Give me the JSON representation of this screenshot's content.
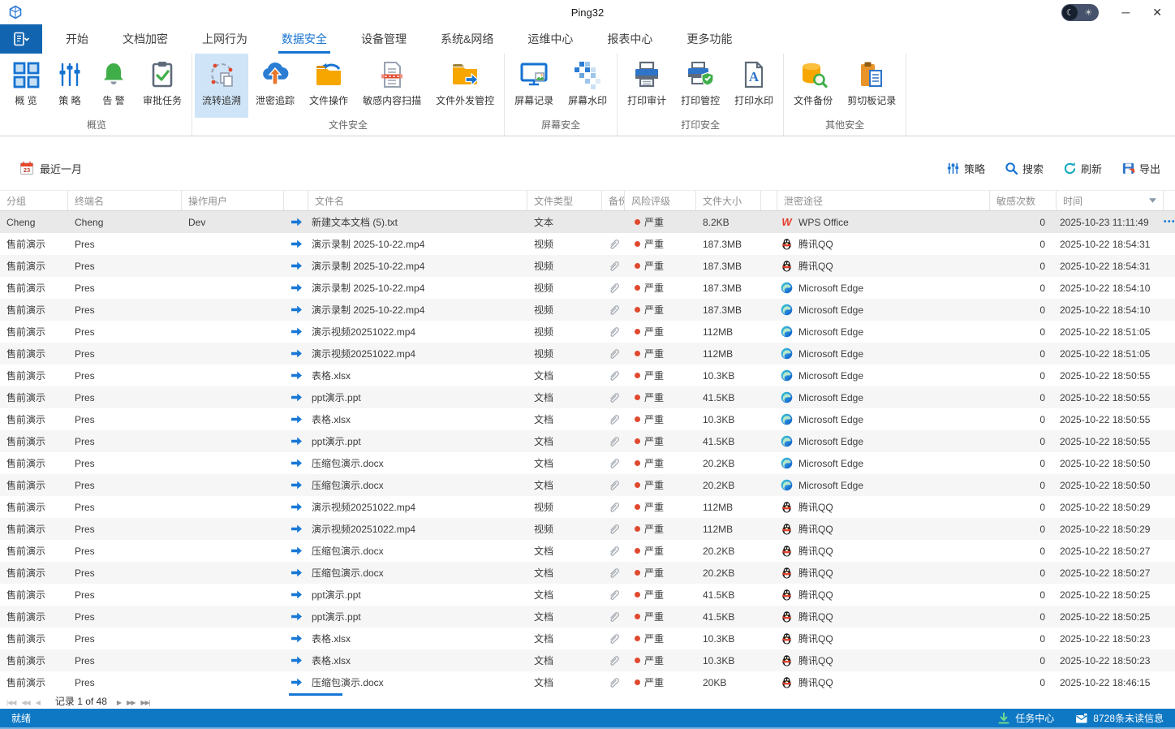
{
  "window": {
    "title": "Ping32",
    "controls": {
      "minimize": "─",
      "close": "✕"
    },
    "theme_toggle": {
      "moon": "☾",
      "sun": "☀"
    }
  },
  "tabs": {
    "active_index": 3,
    "items": [
      "开始",
      "文档加密",
      "上网行为",
      "数据安全",
      "设备管理",
      "系统&网络",
      "运维中心",
      "报表中心",
      "更多功能"
    ]
  },
  "ribbon": {
    "groups": [
      {
        "label": "概览",
        "buttons": [
          {
            "key": "overview",
            "label": "概 览",
            "icon": "overview-grid-icon",
            "active": false
          },
          {
            "key": "policy",
            "label": "策 略",
            "icon": "policy-sliders-icon",
            "active": false
          },
          {
            "key": "alert",
            "label": "告 警",
            "icon": "alert-bell-icon",
            "active": false
          },
          {
            "key": "approval-tasks",
            "label": "审批任务",
            "icon": "approval-clipboard-icon",
            "active": false
          }
        ]
      },
      {
        "label": "文件安全",
        "buttons": [
          {
            "key": "flow-trace",
            "label": "流转追溯",
            "icon": "flow-trace-icon",
            "active": true
          },
          {
            "key": "leak-track",
            "label": "泄密追踪",
            "icon": "leak-track-cloud-icon",
            "active": false
          },
          {
            "key": "file-ops",
            "label": "文件操作",
            "icon": "file-ops-folder-icon",
            "active": false
          },
          {
            "key": "content-scan",
            "label": "敏感内容扫描",
            "icon": "content-scan-icon",
            "active": false
          },
          {
            "key": "file-outgoing",
            "label": "文件外发管控",
            "icon": "file-outgoing-folder-icon",
            "active": false
          }
        ]
      },
      {
        "label": "屏幕安全",
        "buttons": [
          {
            "key": "screen-record",
            "label": "屏幕记录",
            "icon": "screen-record-icon",
            "active": false
          },
          {
            "key": "screen-watermark",
            "label": "屏幕水印",
            "icon": "screen-watermark-icon",
            "active": false
          }
        ]
      },
      {
        "label": "打印安全",
        "buttons": [
          {
            "key": "print-audit",
            "label": "打印审计",
            "icon": "print-audit-icon",
            "active": false
          },
          {
            "key": "print-control",
            "label": "打印管控",
            "icon": "print-control-icon",
            "active": false
          },
          {
            "key": "print-watermark",
            "label": "打印水印",
            "icon": "print-watermark-icon",
            "active": false
          }
        ]
      },
      {
        "label": "其他安全",
        "buttons": [
          {
            "key": "file-backup",
            "label": "文件备份",
            "icon": "file-backup-icon",
            "active": false
          },
          {
            "key": "clipboard-record",
            "label": "剪切板记录",
            "icon": "clipboard-record-icon",
            "active": false
          }
        ]
      }
    ]
  },
  "filterbar": {
    "date_range": "最近一月",
    "calendar_day": "23",
    "actions": [
      {
        "key": "policy",
        "label": "策略",
        "icon": "policy-filter-icon"
      },
      {
        "key": "search",
        "label": "搜索",
        "icon": "search-icon"
      },
      {
        "key": "refresh",
        "label": "刷新",
        "icon": "refresh-icon"
      },
      {
        "key": "export",
        "label": "导出",
        "icon": "export-icon"
      }
    ]
  },
  "table": {
    "risk_color": "#e0492e",
    "accent_color": "#1778d6",
    "columns": [
      {
        "label": "分组"
      },
      {
        "label": "终端名"
      },
      {
        "label": "操作用户"
      },
      {
        "label": ""
      },
      {
        "label": "文件名"
      },
      {
        "label": "文件类型"
      },
      {
        "label": "备份"
      },
      {
        "label": "风险评级"
      },
      {
        "label": "文件大小"
      },
      {
        "label": ""
      },
      {
        "label": "泄密途径"
      },
      {
        "label": "敏感次数"
      },
      {
        "label": "时间",
        "filter_arrow": true
      },
      {
        "label": ""
      }
    ],
    "rows": [
      {
        "group": "Cheng",
        "terminal": "Cheng",
        "user": "Dev",
        "file": "新建文本文档 (5).txt",
        "type": "文本",
        "backup": false,
        "risk": "严重",
        "size": "8.2KB",
        "channel": "wps",
        "channel_label": "WPS Office",
        "count": "0",
        "time": "2025-10-23 11:11:49",
        "selected": true,
        "actions": "•••"
      },
      {
        "group": "售前演示",
        "terminal": "Pres",
        "user": "",
        "file": "演示录制 2025-10-22.mp4",
        "type": "视频",
        "backup": true,
        "risk": "严重",
        "size": "187.3MB",
        "channel": "qq",
        "channel_label": "腾讯QQ",
        "count": "0",
        "time": "2025-10-22 18:54:31"
      },
      {
        "group": "售前演示",
        "terminal": "Pres",
        "user": "",
        "file": "演示录制 2025-10-22.mp4",
        "type": "视频",
        "backup": true,
        "risk": "严重",
        "size": "187.3MB",
        "channel": "qq",
        "channel_label": "腾讯QQ",
        "count": "0",
        "time": "2025-10-22 18:54:31"
      },
      {
        "group": "售前演示",
        "terminal": "Pres",
        "user": "",
        "file": "演示录制 2025-10-22.mp4",
        "type": "视频",
        "backup": true,
        "risk": "严重",
        "size": "187.3MB",
        "channel": "edge",
        "channel_label": "Microsoft Edge",
        "count": "0",
        "time": "2025-10-22 18:54:10"
      },
      {
        "group": "售前演示",
        "terminal": "Pres",
        "user": "",
        "file": "演示录制 2025-10-22.mp4",
        "type": "视频",
        "backup": true,
        "risk": "严重",
        "size": "187.3MB",
        "channel": "edge",
        "channel_label": "Microsoft Edge",
        "count": "0",
        "time": "2025-10-22 18:54:10"
      },
      {
        "group": "售前演示",
        "terminal": "Pres",
        "user": "",
        "file": "演示视频20251022.mp4",
        "type": "视频",
        "backup": true,
        "risk": "严重",
        "size": "112MB",
        "channel": "edge",
        "channel_label": "Microsoft Edge",
        "count": "0",
        "time": "2025-10-22 18:51:05"
      },
      {
        "group": "售前演示",
        "terminal": "Pres",
        "user": "",
        "file": "演示视频20251022.mp4",
        "type": "视频",
        "backup": true,
        "risk": "严重",
        "size": "112MB",
        "channel": "edge",
        "channel_label": "Microsoft Edge",
        "count": "0",
        "time": "2025-10-22 18:51:05"
      },
      {
        "group": "售前演示",
        "terminal": "Pres",
        "user": "",
        "file": "表格.xlsx",
        "type": "文档",
        "backup": true,
        "risk": "严重",
        "size": "10.3KB",
        "channel": "edge",
        "channel_label": "Microsoft Edge",
        "count": "0",
        "time": "2025-10-22 18:50:55"
      },
      {
        "group": "售前演示",
        "terminal": "Pres",
        "user": "",
        "file": "ppt演示.ppt",
        "type": "文档",
        "backup": true,
        "risk": "严重",
        "size": "41.5KB",
        "channel": "edge",
        "channel_label": "Microsoft Edge",
        "count": "0",
        "time": "2025-10-22 18:50:55"
      },
      {
        "group": "售前演示",
        "terminal": "Pres",
        "user": "",
        "file": "表格.xlsx",
        "type": "文档",
        "backup": true,
        "risk": "严重",
        "size": "10.3KB",
        "channel": "edge",
        "channel_label": "Microsoft Edge",
        "count": "0",
        "time": "2025-10-22 18:50:55"
      },
      {
        "group": "售前演示",
        "terminal": "Pres",
        "user": "",
        "file": "ppt演示.ppt",
        "type": "文档",
        "backup": true,
        "risk": "严重",
        "size": "41.5KB",
        "channel": "edge",
        "channel_label": "Microsoft Edge",
        "count": "0",
        "time": "2025-10-22 18:50:55"
      },
      {
        "group": "售前演示",
        "terminal": "Pres",
        "user": "",
        "file": "压缩包演示.docx",
        "type": "文档",
        "backup": true,
        "risk": "严重",
        "size": "20.2KB",
        "channel": "edge",
        "channel_label": "Microsoft Edge",
        "count": "0",
        "time": "2025-10-22 18:50:50"
      },
      {
        "group": "售前演示",
        "terminal": "Pres",
        "user": "",
        "file": "压缩包演示.docx",
        "type": "文档",
        "backup": true,
        "risk": "严重",
        "size": "20.2KB",
        "channel": "edge",
        "channel_label": "Microsoft Edge",
        "count": "0",
        "time": "2025-10-22 18:50:50"
      },
      {
        "group": "售前演示",
        "terminal": "Pres",
        "user": "",
        "file": "演示视频20251022.mp4",
        "type": "视频",
        "backup": true,
        "risk": "严重",
        "size": "112MB",
        "channel": "qq",
        "channel_label": "腾讯QQ",
        "count": "0",
        "time": "2025-10-22 18:50:29"
      },
      {
        "group": "售前演示",
        "terminal": "Pres",
        "user": "",
        "file": "演示视频20251022.mp4",
        "type": "视频",
        "backup": true,
        "risk": "严重",
        "size": "112MB",
        "channel": "qq",
        "channel_label": "腾讯QQ",
        "count": "0",
        "time": "2025-10-22 18:50:29"
      },
      {
        "group": "售前演示",
        "terminal": "Pres",
        "user": "",
        "file": "压缩包演示.docx",
        "type": "文档",
        "backup": true,
        "risk": "严重",
        "size": "20.2KB",
        "channel": "qq",
        "channel_label": "腾讯QQ",
        "count": "0",
        "time": "2025-10-22 18:50:27"
      },
      {
        "group": "售前演示",
        "terminal": "Pres",
        "user": "",
        "file": "压缩包演示.docx",
        "type": "文档",
        "backup": true,
        "risk": "严重",
        "size": "20.2KB",
        "channel": "qq",
        "channel_label": "腾讯QQ",
        "count": "0",
        "time": "2025-10-22 18:50:27"
      },
      {
        "group": "售前演示",
        "terminal": "Pres",
        "user": "",
        "file": "ppt演示.ppt",
        "type": "文档",
        "backup": true,
        "risk": "严重",
        "size": "41.5KB",
        "channel": "qq",
        "channel_label": "腾讯QQ",
        "count": "0",
        "time": "2025-10-22 18:50:25"
      },
      {
        "group": "售前演示",
        "terminal": "Pres",
        "user": "",
        "file": "ppt演示.ppt",
        "type": "文档",
        "backup": true,
        "risk": "严重",
        "size": "41.5KB",
        "channel": "qq",
        "channel_label": "腾讯QQ",
        "count": "0",
        "time": "2025-10-22 18:50:25"
      },
      {
        "group": "售前演示",
        "terminal": "Pres",
        "user": "",
        "file": "表格.xlsx",
        "type": "文档",
        "backup": true,
        "risk": "严重",
        "size": "10.3KB",
        "channel": "qq",
        "channel_label": "腾讯QQ",
        "count": "0",
        "time": "2025-10-22 18:50:23"
      },
      {
        "group": "售前演示",
        "terminal": "Pres",
        "user": "",
        "file": "表格.xlsx",
        "type": "文档",
        "backup": true,
        "risk": "严重",
        "size": "10.3KB",
        "channel": "qq",
        "channel_label": "腾讯QQ",
        "count": "0",
        "time": "2025-10-22 18:50:23"
      },
      {
        "group": "售前演示",
        "terminal": "Pres",
        "user": "",
        "file": "压缩包演示.docx",
        "type": "文档",
        "backup": true,
        "risk": "严重",
        "size": "20KB",
        "channel": "qq",
        "channel_label": "腾讯QQ",
        "count": "0",
        "time": "2025-10-22 18:46:15"
      }
    ]
  },
  "pager": {
    "label": "记录 1 of 48",
    "back_buttons": [
      "|◀◀",
      "◀◀",
      "◀"
    ],
    "forward_buttons": [
      "▶",
      "▶▶",
      "▶▶|"
    ]
  },
  "statusbar": {
    "status": "就绪",
    "task_center": "任务中心",
    "unread": "8728条未读信息"
  }
}
